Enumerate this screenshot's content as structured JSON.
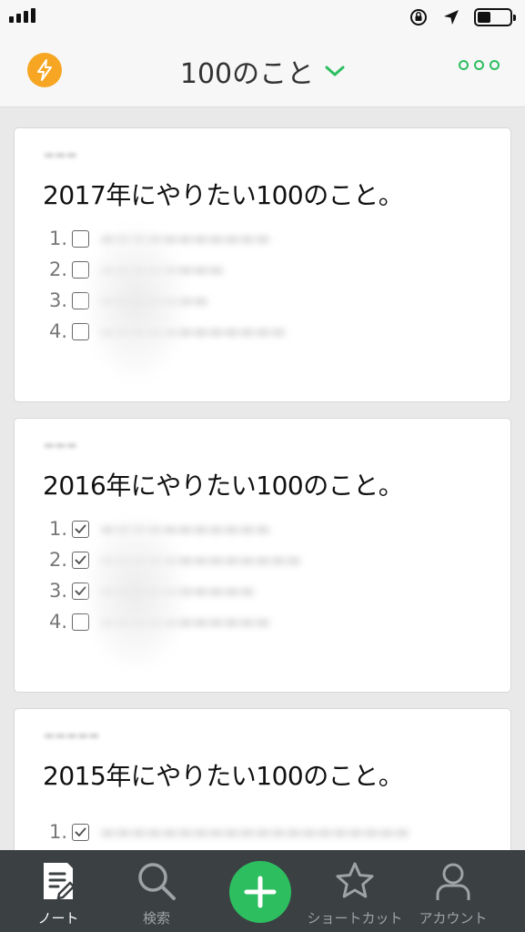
{
  "status_bar": {
    "battery_level": 0.4
  },
  "header": {
    "title": "100のこと",
    "bolt_icon": "bolt-icon",
    "dropdown_icon": "chevron-down-icon",
    "more_icon": "more-dots-icon",
    "accent_color": "#2dbe60",
    "bolt_color": "#f6a623"
  },
  "notes": [
    {
      "title": "2017年にやりたい100のこと。",
      "items": [
        {
          "num": "1.",
          "checked": false
        },
        {
          "num": "2.",
          "checked": false
        },
        {
          "num": "3.",
          "checked": false
        },
        {
          "num": "4.",
          "checked": false
        }
      ]
    },
    {
      "title": "2016年にやりたい100のこと。",
      "items": [
        {
          "num": "1.",
          "checked": true
        },
        {
          "num": "2.",
          "checked": true
        },
        {
          "num": "3.",
          "checked": true
        },
        {
          "num": "4.",
          "checked": false
        }
      ]
    },
    {
      "title": "2015年にやりたい100のこと。",
      "items": [
        {
          "num": "1.",
          "checked": true
        }
      ]
    }
  ],
  "tabbar": {
    "tabs": [
      {
        "label": "ノート",
        "icon": "note-icon",
        "active": true
      },
      {
        "label": "検索",
        "icon": "search-icon",
        "active": false
      },
      {
        "label": "ショートカット",
        "icon": "star-icon",
        "active": false
      },
      {
        "label": "アカウント",
        "icon": "account-icon",
        "active": false
      }
    ],
    "add_icon": "plus-icon",
    "background": "#3b4043"
  }
}
